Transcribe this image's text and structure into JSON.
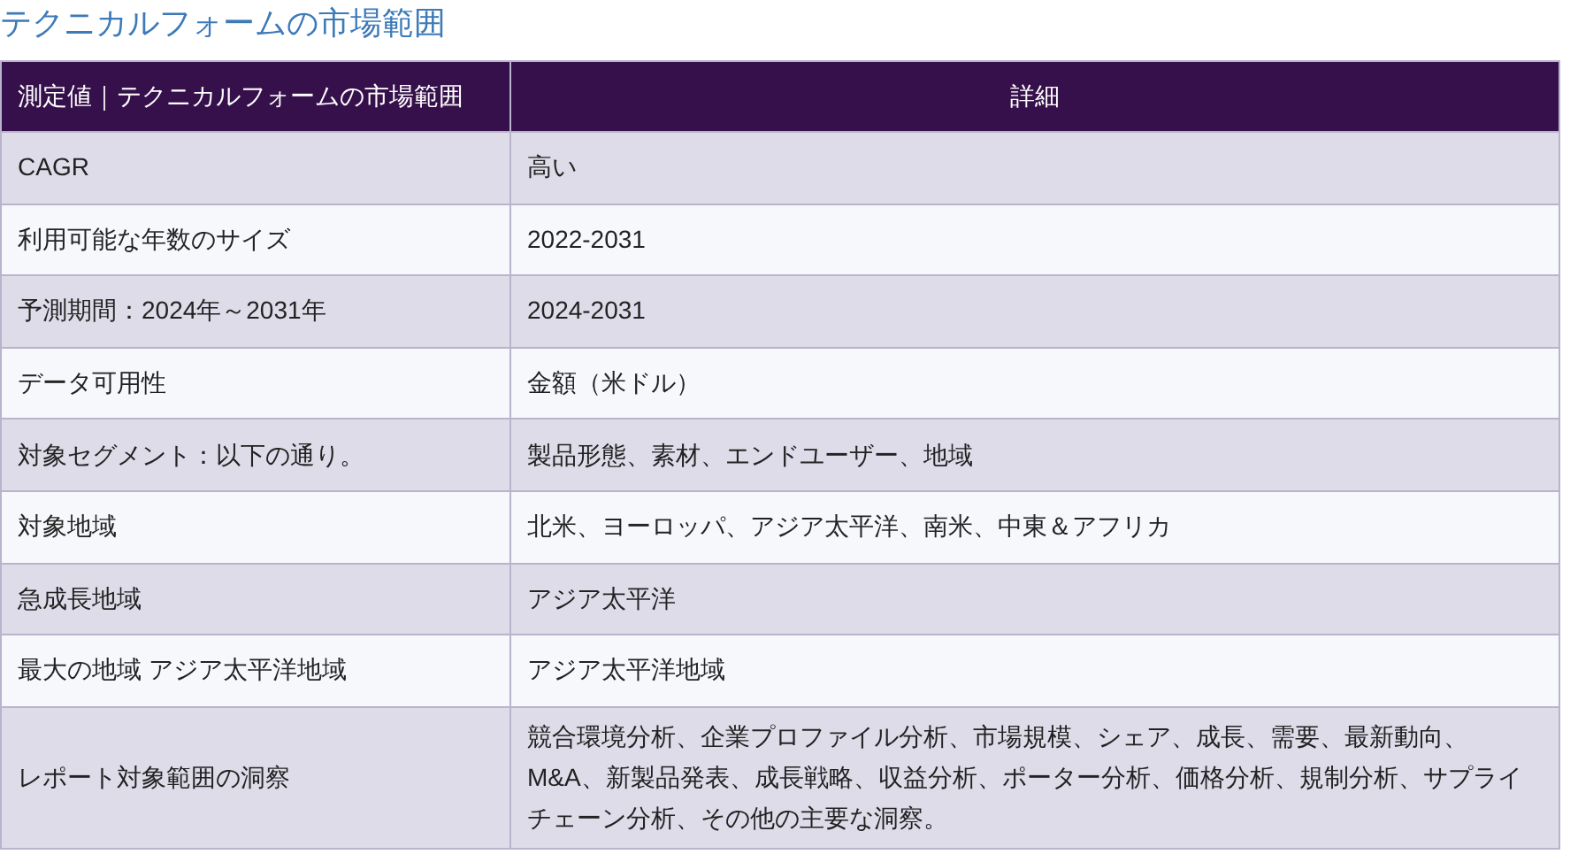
{
  "title": "テクニカルフォームの市場範囲",
  "table": {
    "columns": [
      "測定値｜テクニカルフォームの市場範囲",
      "詳細"
    ],
    "rows": [
      [
        "CAGR",
        "高い"
      ],
      [
        "利用可能な年数のサイズ",
        "2022-2031"
      ],
      [
        "予測期間：2024年～2031年",
        "2024-2031"
      ],
      [
        "データ可用性",
        "金額（米ドル）"
      ],
      [
        "対象セグメント：以下の通り。",
        "製品形態、素材、エンドユーザー、地域"
      ],
      [
        "対象地域",
        "北米、ヨーロッパ、アジア太平洋、南米、中東＆アフリカ"
      ],
      [
        "急成長地域",
        "アジア太平洋"
      ],
      [
        "最大の地域 アジア太平洋地域",
        "アジア太平洋地域"
      ],
      [
        "レポート対象範囲の洞察",
        "競合環境分析、企業プロファイル分析、市場規模、シェア、成長、需要、最新動向、M&A、新製品発表、成長戦略、収益分析、ポーター分析、価格分析、規制分析、サプライチェーン分析、その他の主要な洞察。"
      ]
    ]
  }
}
